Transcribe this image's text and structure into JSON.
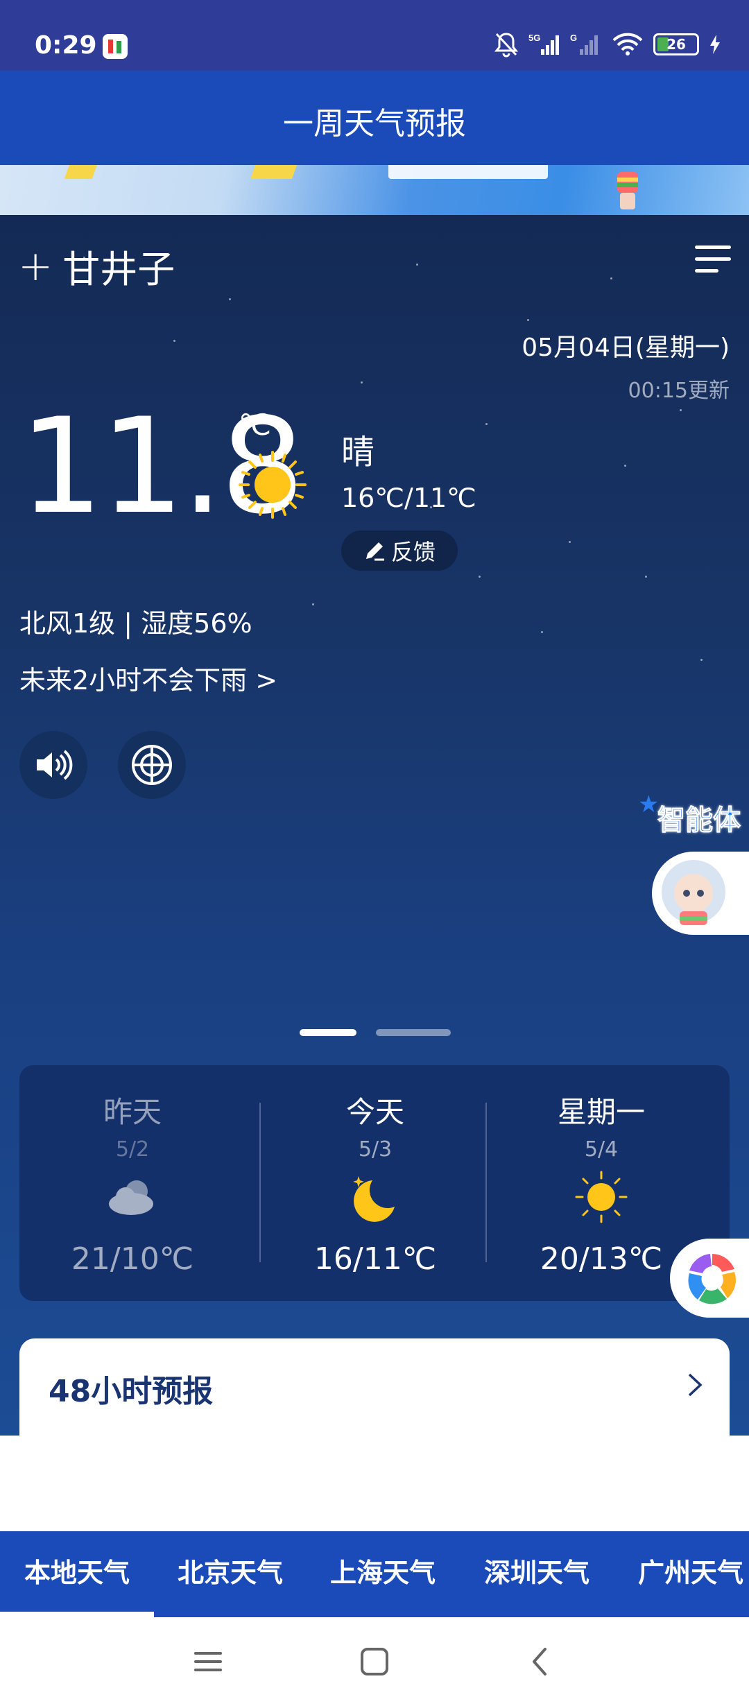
{
  "status_bar": {
    "time": "0:29",
    "battery": "26",
    "icons": [
      "notifications-off-icon",
      "5g-signal-icon",
      "signal-icon",
      "wifi-icon",
      "battery-icon",
      "charging-icon"
    ]
  },
  "header": {
    "title": "一周天气预报"
  },
  "location": {
    "city": "甘井子"
  },
  "current": {
    "date": "05月04日(星期一)",
    "update": "00:15更新",
    "temperature": "11.8",
    "unit": "℃",
    "condition": "晴",
    "range": "16℃/11℃",
    "feedback_label": "反馈",
    "wind_humidity": "北风1级 | 湿度56%",
    "rain_notice": "未来2小时不会下雨 >"
  },
  "agent": {
    "label": "智能体"
  },
  "pager": {
    "pages": 2,
    "active": 0
  },
  "days": [
    {
      "name": "昨天",
      "date": "5/2",
      "icon": "cloudy-icon",
      "temps": "21/10℃"
    },
    {
      "name": "今天",
      "date": "5/3",
      "icon": "moon-icon",
      "temps": "16/11℃"
    },
    {
      "name": "星期一",
      "date": "5/4",
      "icon": "sun-icon",
      "temps": "20/13℃"
    }
  ],
  "forecast48": {
    "title": "48小时预报"
  },
  "tabs": [
    "本地天气",
    "北京天气",
    "上海天气",
    "深圳天气",
    "广州天气"
  ],
  "colors": {
    "header": "#1a4bb8",
    "sun": "#ffc619",
    "card": "#14306a"
  }
}
